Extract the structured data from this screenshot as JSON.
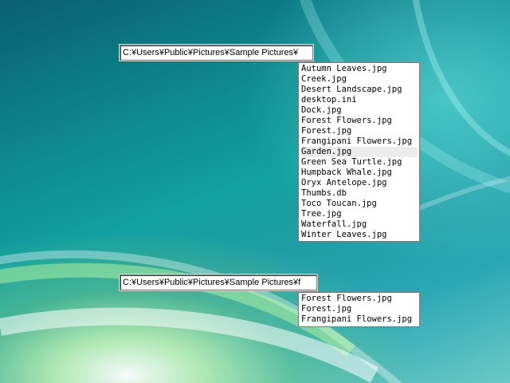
{
  "autocomplete_1": {
    "address_value": "C:¥Users¥Public¥Pictures¥Sample Pictures¥",
    "hovered_index": 8,
    "items": [
      "Autumn Leaves.jpg",
      "Creek.jpg",
      "Desert Landscape.jpg",
      "desktop.ini",
      "Dock.jpg",
      "Forest Flowers.jpg",
      "Forest.jpg",
      "Frangipani Flowers.jpg",
      "Garden.jpg",
      "Green Sea Turtle.jpg",
      "Humpback Whale.jpg",
      "Oryx Antelope.jpg",
      "Thumbs.db",
      "Toco Toucan.jpg",
      "Tree.jpg",
      "Waterfall.jpg",
      "Winter Leaves.jpg"
    ]
  },
  "autocomplete_2": {
    "address_value": "C:¥Users¥Public¥Pictures¥Sample Pictures¥f",
    "items": [
      "Forest Flowers.jpg",
      "Forest.jpg",
      "Frangipani Flowers.jpg"
    ]
  },
  "colors": {
    "desktop_base": "#0e8a8f",
    "list_hover": "#ececec"
  }
}
